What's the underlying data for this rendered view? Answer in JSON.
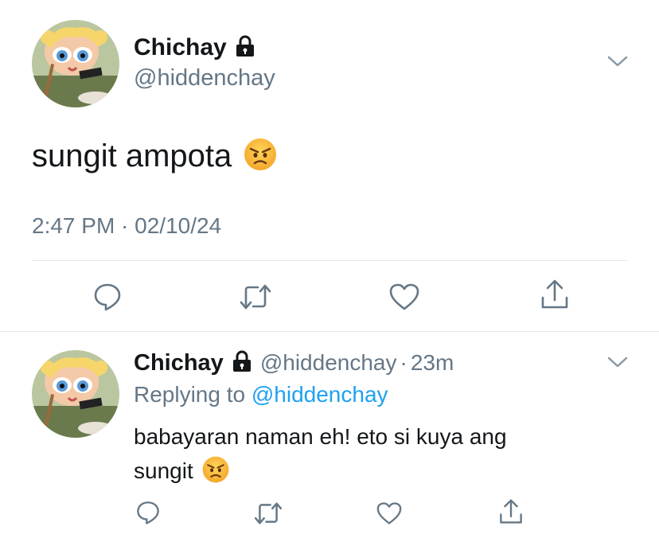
{
  "tweet": {
    "display_name": "Chichay",
    "handle": "@hiddenchay",
    "text": "sungit ampota",
    "timestamp": "2:47 PM · 02/10/24",
    "icons": [
      "lock-icon",
      "chevron-down-icon",
      "angry-face-emoji",
      "reply-icon",
      "retweet-icon",
      "like-icon",
      "share-icon"
    ]
  },
  "reply": {
    "display_name": "Chichay",
    "handle": "@hiddenchay",
    "separator": "·",
    "time_ago": "23m",
    "replying_prefix": "Replying to",
    "replying_handle": "@hiddenchay",
    "text_line1": "babayaran naman eh! eto si kuya ang",
    "text_line2": "sungit",
    "icons": [
      "lock-icon",
      "chevron-down-icon",
      "angry-face-emoji",
      "reply-icon",
      "retweet-icon",
      "like-icon",
      "share-icon"
    ]
  },
  "colors": {
    "text": "#14171a",
    "secondary": "#657786",
    "link": "#1da1f2",
    "divider": "#e1e8ed"
  }
}
